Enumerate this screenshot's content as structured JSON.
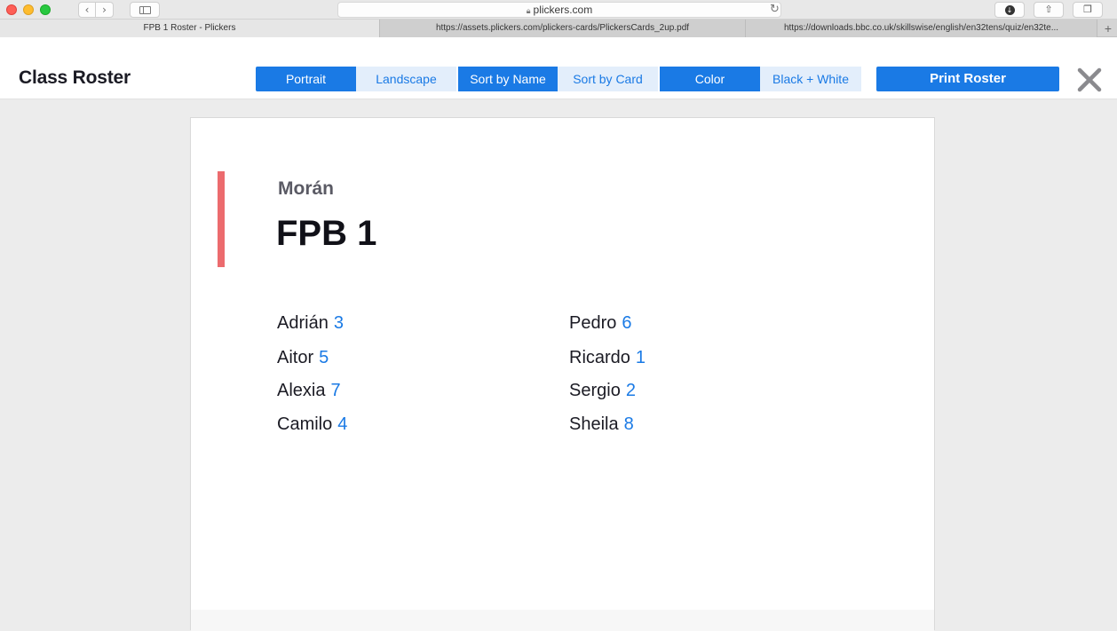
{
  "browser": {
    "address": "plickers.com",
    "tabs": [
      {
        "label": "FPB 1 Roster - Plickers"
      },
      {
        "label": "https://assets.plickers.com/plickers-cards/PlickersCards_2up.pdf"
      },
      {
        "label": "https://downloads.bbc.co.uk/skillswise/english/en32tens/quiz/en32te..."
      }
    ],
    "new_tab": "+"
  },
  "toolbar": {
    "title": "Class Roster",
    "orientation": {
      "portrait": "Portrait",
      "landscape": "Landscape",
      "selected": "Portrait"
    },
    "sort": {
      "by_name": "Sort by Name",
      "by_card": "Sort by Card",
      "selected": "Sort by Name"
    },
    "color_mode": {
      "color": "Color",
      "bw": "Black + White",
      "selected": "Color"
    },
    "print_label": "Print Roster"
  },
  "roster": {
    "teacher": "Morán",
    "class_name": "FPB 1",
    "accent_color": "#ec6b6e",
    "students": [
      {
        "name": "Adrián",
        "card": "3"
      },
      {
        "name": "Aitor",
        "card": "5"
      },
      {
        "name": "Alexia",
        "card": "7"
      },
      {
        "name": "Camilo",
        "card": "4"
      },
      {
        "name": "Pedro",
        "card": "6"
      },
      {
        "name": "Ricardo",
        "card": "1"
      },
      {
        "name": "Sergio",
        "card": "2"
      },
      {
        "name": "Sheila",
        "card": "8"
      }
    ]
  },
  "colors": {
    "primary": "#1a7ae5",
    "primary_light": "#e3eefb"
  }
}
